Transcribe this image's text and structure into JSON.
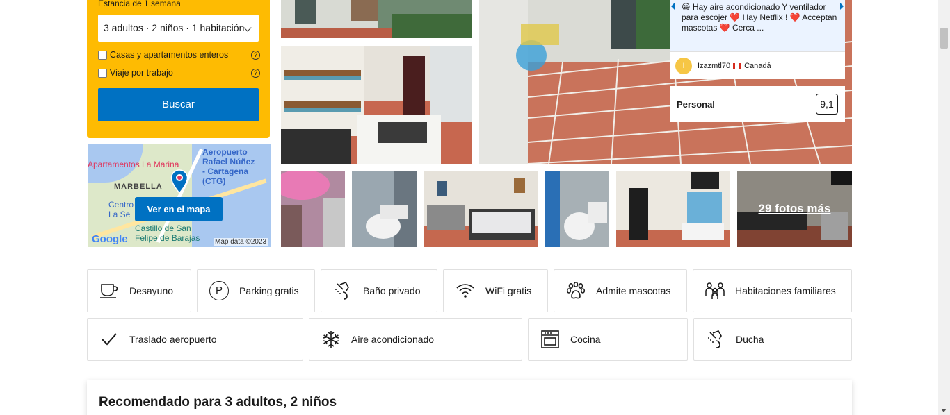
{
  "search": {
    "stay_label": "Estancia de 1 semana",
    "guests": "3 adultos · 2 niños · 1 habitación",
    "checkbox_homes": "Casas y apartamentos enteros",
    "checkbox_work": "Viaje por trabajo",
    "help_glyph": "?",
    "button": "Buscar"
  },
  "map": {
    "label_airport_1": "Aeropuerto",
    "label_airport_2": "Rafael Núñez",
    "label_airport_3": "- Cartagena",
    "label_airport_4": "(CTG)",
    "label_apartments": "Apartamentos La Marina",
    "label_marbella": "MARBELLA",
    "label_centro_1": "Centro",
    "label_centro_2": "La Se",
    "label_castillo_1": "Castillo de San",
    "label_castillo_2": "Felipe de Barajas",
    "button": "Ver en el mapa",
    "google": "Google",
    "map_data": "Map data ©2023"
  },
  "photos": {
    "more": "29 fotos más"
  },
  "review": {
    "text": "Hay aire acondicionado Y ventilador para escojer ❤️ Hay Netflix ! ❤️  Acceptan mascotas ❤️ Cerca ...",
    "emoji": "😀",
    "avatar": "I",
    "reviewer": "Izazmtl70",
    "country": "Canadá"
  },
  "staff": {
    "label": "Personal",
    "score": "9,1"
  },
  "facilities": {
    "row1": [
      {
        "label": "Desayuno",
        "icon": "cup-icon"
      },
      {
        "label": "Parking gratis",
        "icon": "parking-icon"
      },
      {
        "label": "Baño privado",
        "icon": "shower-icon"
      },
      {
        "label": "WiFi gratis",
        "icon": "wifi-icon"
      },
      {
        "label": "Admite mascotas",
        "icon": "paw-icon"
      },
      {
        "label": "Habitaciones familiares",
        "icon": "family-icon"
      }
    ],
    "row2": [
      {
        "label": "Traslado aeropuerto",
        "icon": "check-icon"
      },
      {
        "label": "Aire acondicionado",
        "icon": "snowflake-icon"
      },
      {
        "label": "Cocina",
        "icon": "oven-icon"
      },
      {
        "label": "Ducha",
        "icon": "shower-icon"
      }
    ],
    "parking_glyph": "P"
  },
  "recommended": {
    "title": "Recomendado para 3 adultos, 2 niños"
  }
}
